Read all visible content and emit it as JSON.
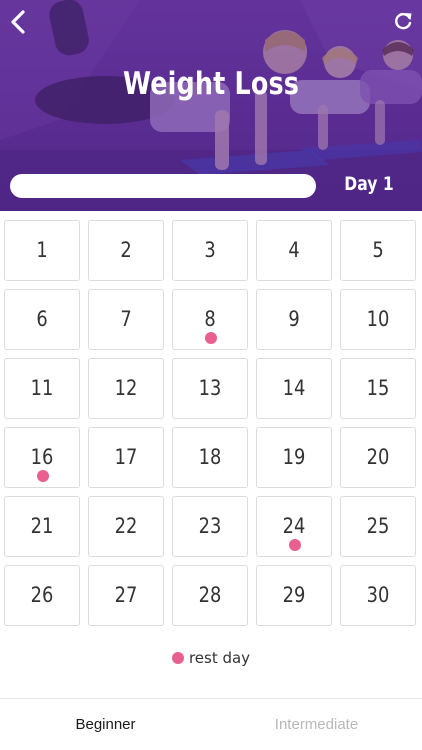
{
  "header": {
    "title": "Weight Loss",
    "day_label": "Day 1",
    "progress_fraction": 0,
    "back_icon": "chevron-left-icon",
    "refresh_icon": "refresh-icon"
  },
  "calendar": {
    "days": [
      {
        "label": "1",
        "rest": false
      },
      {
        "label": "2",
        "rest": false
      },
      {
        "label": "3",
        "rest": false
      },
      {
        "label": "4",
        "rest": false
      },
      {
        "label": "5",
        "rest": false
      },
      {
        "label": "6",
        "rest": false
      },
      {
        "label": "7",
        "rest": false
      },
      {
        "label": "8",
        "rest": true
      },
      {
        "label": "9",
        "rest": false
      },
      {
        "label": "10",
        "rest": false
      },
      {
        "label": "11",
        "rest": false
      },
      {
        "label": "12",
        "rest": false
      },
      {
        "label": "13",
        "rest": false
      },
      {
        "label": "14",
        "rest": false
      },
      {
        "label": "15",
        "rest": false
      },
      {
        "label": "16",
        "rest": true
      },
      {
        "label": "17",
        "rest": false
      },
      {
        "label": "18",
        "rest": false
      },
      {
        "label": "19",
        "rest": false
      },
      {
        "label": "20",
        "rest": false
      },
      {
        "label": "21",
        "rest": false
      },
      {
        "label": "22",
        "rest": false
      },
      {
        "label": "23",
        "rest": false
      },
      {
        "label": "24",
        "rest": true
      },
      {
        "label": "25",
        "rest": false
      },
      {
        "label": "26",
        "rest": false
      },
      {
        "label": "27",
        "rest": false
      },
      {
        "label": "28",
        "rest": false
      },
      {
        "label": "29",
        "rest": false
      },
      {
        "label": "30",
        "rest": false
      }
    ]
  },
  "legend": {
    "label": "rest day"
  },
  "tabs": [
    {
      "label": "Beginner",
      "active": true
    },
    {
      "label": "Intermediate",
      "active": false
    }
  ],
  "colors": {
    "accent_rest": "#e85f90",
    "header_purple": "#5a2d92",
    "cell_border": "#dcdcdc"
  }
}
